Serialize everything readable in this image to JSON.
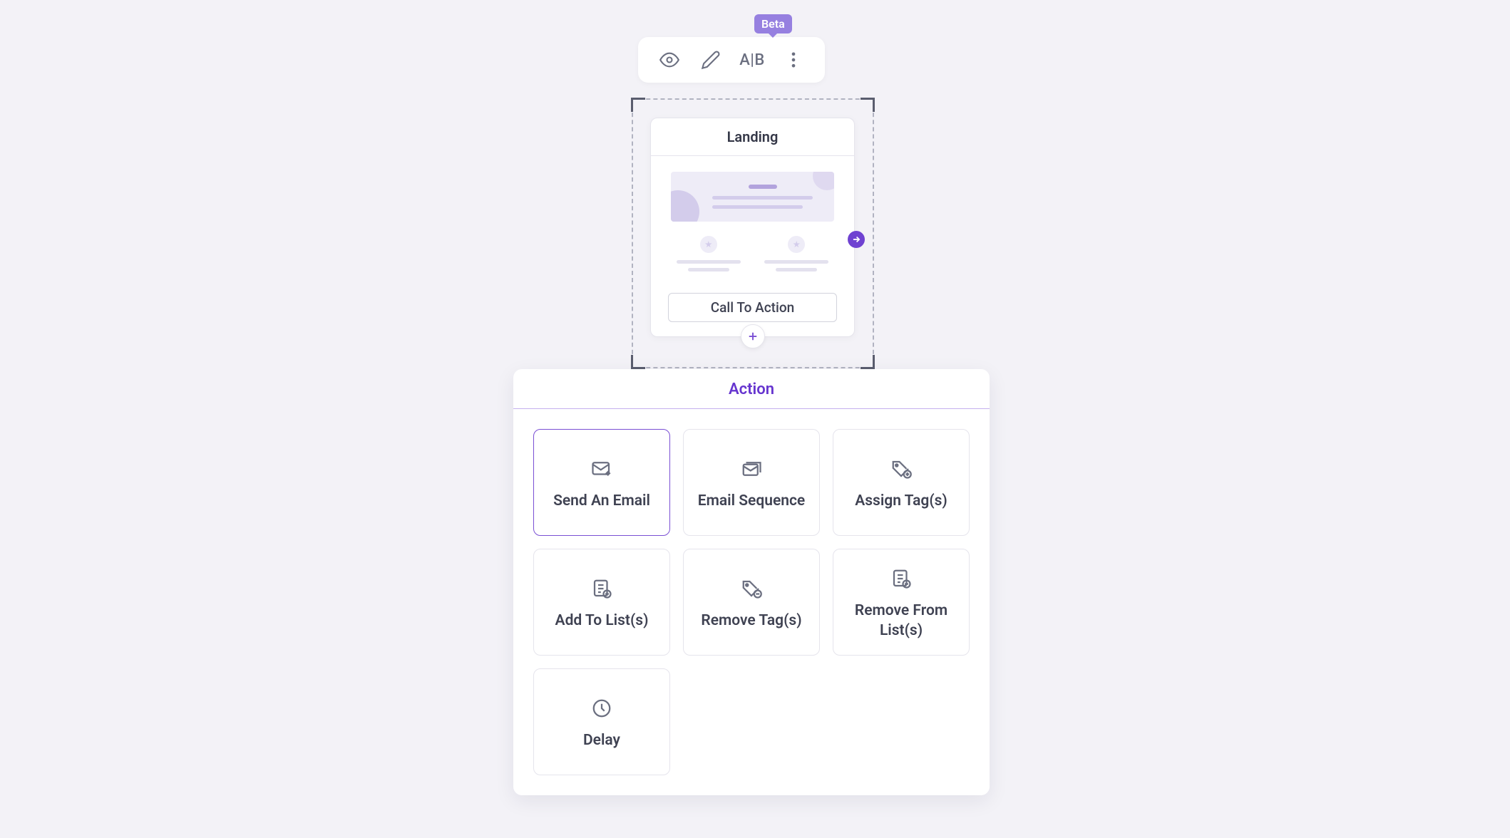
{
  "toolbar": {
    "beta_label": "Beta",
    "ab_label": "A|B"
  },
  "landing": {
    "title": "Landing",
    "cta_label": "Call To Action"
  },
  "action_panel": {
    "title": "Action",
    "actions": [
      {
        "label": "Send An Email",
        "icon": "mail-edit",
        "selected": true
      },
      {
        "label": "Email Sequence",
        "icon": "mail-stack",
        "selected": false
      },
      {
        "label": "Assign Tag(s)",
        "icon": "tag-plus",
        "selected": false
      },
      {
        "label": "Add To List(s)",
        "icon": "list-plus",
        "selected": false
      },
      {
        "label": "Remove Tag(s)",
        "icon": "tag-minus",
        "selected": false
      },
      {
        "label": "Remove From List(s)",
        "icon": "list-minus",
        "selected": false
      },
      {
        "label": "Delay",
        "icon": "clock",
        "selected": false
      }
    ]
  }
}
